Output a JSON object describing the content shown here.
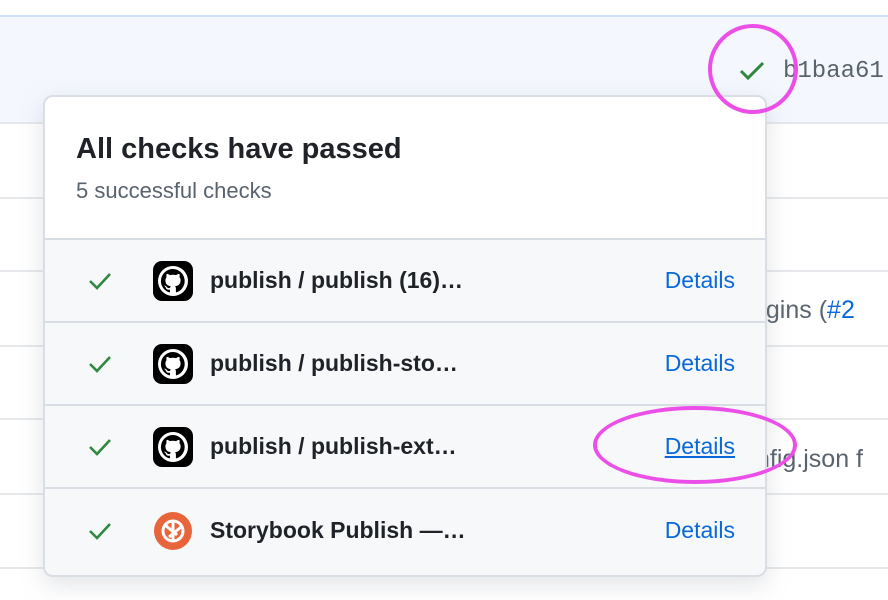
{
  "commit": {
    "sha": "b1baa61",
    "status_icon": "check-icon"
  },
  "background_rows": [
    {
      "text_prefix": "ugins (",
      "link": "#2"
    },
    {
      "text_prefix": "nfig.json f",
      "link": ""
    }
  ],
  "popover": {
    "title": "All checks have passed",
    "subtitle": "5 successful checks",
    "checks": [
      {
        "name": "publish / publish (16)…",
        "icon": "github-icon",
        "details": "Details"
      },
      {
        "name": "publish / publish-sto…",
        "icon": "github-icon",
        "details": "Details"
      },
      {
        "name": "publish / publish-ext…",
        "icon": "github-icon",
        "details": "Details"
      },
      {
        "name": "Storybook Publish —…",
        "icon": "storybook-icon",
        "details": "Details"
      }
    ]
  },
  "colors": {
    "success": "#2f883f",
    "link": "#0969da",
    "annotation": "#ec4fe8",
    "storybook": "#e8643a"
  }
}
